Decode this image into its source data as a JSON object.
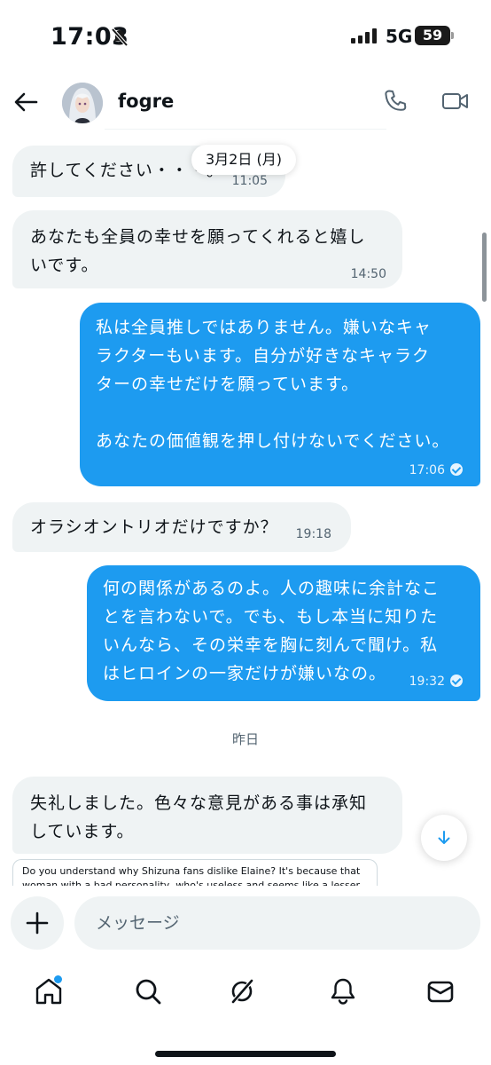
{
  "status_bar": {
    "time": "17:03",
    "network": "5G",
    "battery": "59"
  },
  "header": {
    "username": "fogre"
  },
  "messages": [
    {
      "dir": "in",
      "text": "許してください・・・。",
      "time": "11:05"
    },
    {
      "dir": "in",
      "text_lines": [
        "あなたも全員の幸せを願ってくれると嬉し",
        "いです。"
      ],
      "time": "14:50"
    },
    {
      "dir": "out",
      "text_lines": [
        "私は全員推しではありません。嫌いなキャ",
        "ラクターもいます。自分が好きなキャラク",
        "ターの幸せだけを願っています。",
        "",
        "あなたの価値観を押し付けないでください。"
      ],
      "time": "17:06"
    },
    {
      "dir": "in",
      "text": "オラシオントリオだけですか？",
      "time": "19:18"
    },
    {
      "dir": "out",
      "text_lines": [
        "何の関係があるのよ。人の趣味に余計なこ",
        "とを言わないで。でも、もし本当に知りた",
        "いんなら、その栄幸を胸に刻んで聞け。私",
        "はヒロインの一家だけが嫌いなの。"
      ],
      "time": "19:32"
    },
    {
      "dir": "in",
      "text_lines": [
        "失礼しました。色々な意見がある事は承知",
        "しています。"
      ]
    }
  ],
  "date_pill": "3月2日 (月)",
  "day_separator": "昨日",
  "link_card": {
    "lines": [
      "Do you understand why Shizuna fans dislike Elaine? It's because that",
      "woman with a bad personality, who's useless and seems like a lesser"
    ]
  },
  "composer": {
    "placeholder": "メッセージ"
  },
  "colors": {
    "accent": "#1d9bf0",
    "incoming_bubble": "#eff3f4",
    "text": "#0f1419",
    "muted": "#536471"
  },
  "tabs": [
    "home-icon",
    "search-icon",
    "grok-icon",
    "notifications-icon",
    "messages-icon"
  ]
}
